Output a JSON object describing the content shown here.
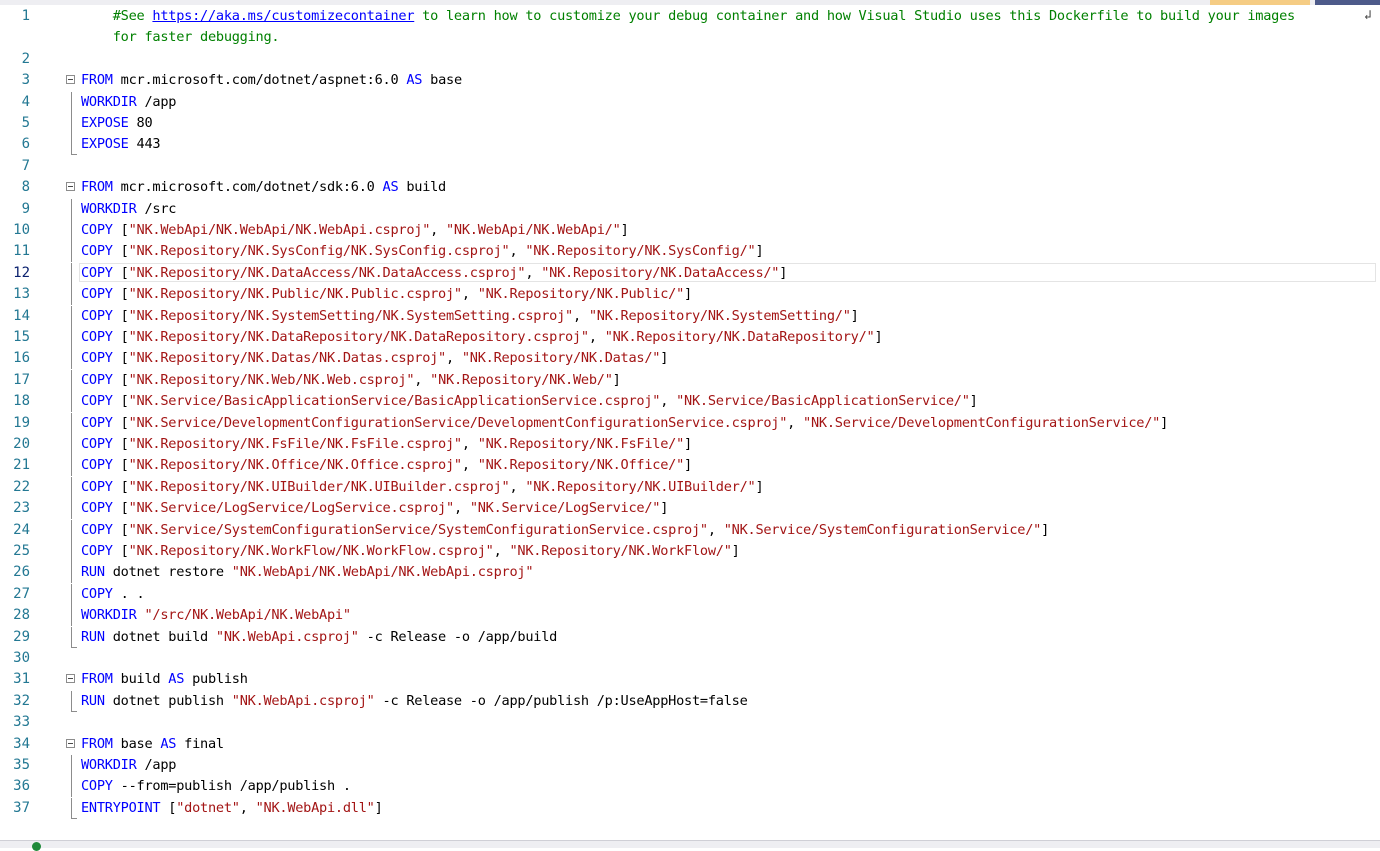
{
  "editor": {
    "language": "Dockerfile",
    "active_line": 12,
    "lines": [
      {
        "n": "1",
        "parts": [
          {
            "t": "    ",
            "c": "cmt"
          },
          {
            "t": "#See ",
            "c": "cmt"
          },
          {
            "t": "https://aka.ms/customizecontainer",
            "c": "link"
          },
          {
            "t": " to learn how to customize your debug container and how Visual Studio uses this Dockerfile to build your images",
            "c": "cmt"
          }
        ]
      },
      {
        "n": "",
        "parts": [
          {
            "t": "    for faster debugging.",
            "c": "cmt"
          }
        ]
      },
      {
        "n": "2",
        "parts": []
      },
      {
        "n": "3",
        "parts": [
          {
            "t": "FROM",
            "c": "kw"
          },
          {
            "t": " mcr.microsoft.com/dotnet/aspnet:6.0 ",
            "c": ""
          },
          {
            "t": "AS",
            "c": "kw"
          },
          {
            "t": " base",
            "c": ""
          }
        ]
      },
      {
        "n": "4",
        "parts": [
          {
            "t": "WORKDIR",
            "c": "kw"
          },
          {
            "t": " /app",
            "c": ""
          }
        ]
      },
      {
        "n": "5",
        "parts": [
          {
            "t": "EXPOSE",
            "c": "kw"
          },
          {
            "t": " 80",
            "c": ""
          }
        ]
      },
      {
        "n": "6",
        "parts": [
          {
            "t": "EXPOSE",
            "c": "kw"
          },
          {
            "t": " 443",
            "c": ""
          }
        ]
      },
      {
        "n": "7",
        "parts": []
      },
      {
        "n": "8",
        "parts": [
          {
            "t": "FROM",
            "c": "kw"
          },
          {
            "t": " mcr.microsoft.com/dotnet/sdk:6.0 ",
            "c": ""
          },
          {
            "t": "AS",
            "c": "kw"
          },
          {
            "t": " build",
            "c": ""
          }
        ]
      },
      {
        "n": "9",
        "parts": [
          {
            "t": "WORKDIR",
            "c": "kw"
          },
          {
            "t": " /src",
            "c": ""
          }
        ]
      },
      {
        "n": "10",
        "parts": [
          {
            "t": "COPY",
            "c": "kw"
          },
          {
            "t": " [",
            "c": ""
          },
          {
            "t": "\"NK.WebApi/NK.WebApi/NK.WebApi.csproj\"",
            "c": "str"
          },
          {
            "t": ", ",
            "c": ""
          },
          {
            "t": "\"NK.WebApi/NK.WebApi/\"",
            "c": "str"
          },
          {
            "t": "]",
            "c": ""
          }
        ]
      },
      {
        "n": "11",
        "parts": [
          {
            "t": "COPY",
            "c": "kw"
          },
          {
            "t": " [",
            "c": ""
          },
          {
            "t": "\"NK.Repository/NK.SysConfig/NK.SysConfig.csproj\"",
            "c": "str"
          },
          {
            "t": ", ",
            "c": ""
          },
          {
            "t": "\"NK.Repository/NK.SysConfig/\"",
            "c": "str"
          },
          {
            "t": "]",
            "c": ""
          }
        ]
      },
      {
        "n": "12",
        "parts": [
          {
            "t": "COPY",
            "c": "kw"
          },
          {
            "t": " [",
            "c": ""
          },
          {
            "t": "\"NK.Repository/NK.DataAccess/NK.DataAccess.csproj\"",
            "c": "str"
          },
          {
            "t": ", ",
            "c": ""
          },
          {
            "t": "\"NK.Repository/NK.DataAccess/\"",
            "c": "str"
          },
          {
            "t": "]",
            "c": ""
          }
        ]
      },
      {
        "n": "13",
        "parts": [
          {
            "t": "COPY",
            "c": "kw"
          },
          {
            "t": " [",
            "c": ""
          },
          {
            "t": "\"NK.Repository/NK.Public/NK.Public.csproj\"",
            "c": "str"
          },
          {
            "t": ", ",
            "c": ""
          },
          {
            "t": "\"NK.Repository/NK.Public/\"",
            "c": "str"
          },
          {
            "t": "]",
            "c": ""
          }
        ]
      },
      {
        "n": "14",
        "parts": [
          {
            "t": "COPY",
            "c": "kw"
          },
          {
            "t": " [",
            "c": ""
          },
          {
            "t": "\"NK.Repository/NK.SystemSetting/NK.SystemSetting.csproj\"",
            "c": "str"
          },
          {
            "t": ", ",
            "c": ""
          },
          {
            "t": "\"NK.Repository/NK.SystemSetting/\"",
            "c": "str"
          },
          {
            "t": "]",
            "c": ""
          }
        ]
      },
      {
        "n": "15",
        "parts": [
          {
            "t": "COPY",
            "c": "kw"
          },
          {
            "t": " [",
            "c": ""
          },
          {
            "t": "\"NK.Repository/NK.DataRepository/NK.DataRepository.csproj\"",
            "c": "str"
          },
          {
            "t": ", ",
            "c": ""
          },
          {
            "t": "\"NK.Repository/NK.DataRepository/\"",
            "c": "str"
          },
          {
            "t": "]",
            "c": ""
          }
        ]
      },
      {
        "n": "16",
        "parts": [
          {
            "t": "COPY",
            "c": "kw"
          },
          {
            "t": " [",
            "c": ""
          },
          {
            "t": "\"NK.Repository/NK.Datas/NK.Datas.csproj\"",
            "c": "str"
          },
          {
            "t": ", ",
            "c": ""
          },
          {
            "t": "\"NK.Repository/NK.Datas/\"",
            "c": "str"
          },
          {
            "t": "]",
            "c": ""
          }
        ]
      },
      {
        "n": "17",
        "parts": [
          {
            "t": "COPY",
            "c": "kw"
          },
          {
            "t": " [",
            "c": ""
          },
          {
            "t": "\"NK.Repository/NK.Web/NK.Web.csproj\"",
            "c": "str"
          },
          {
            "t": ", ",
            "c": ""
          },
          {
            "t": "\"NK.Repository/NK.Web/\"",
            "c": "str"
          },
          {
            "t": "]",
            "c": ""
          }
        ]
      },
      {
        "n": "18",
        "parts": [
          {
            "t": "COPY",
            "c": "kw"
          },
          {
            "t": " [",
            "c": ""
          },
          {
            "t": "\"NK.Service/BasicApplicationService/BasicApplicationService.csproj\"",
            "c": "str"
          },
          {
            "t": ", ",
            "c": ""
          },
          {
            "t": "\"NK.Service/BasicApplicationService/\"",
            "c": "str"
          },
          {
            "t": "]",
            "c": ""
          }
        ]
      },
      {
        "n": "19",
        "parts": [
          {
            "t": "COPY",
            "c": "kw"
          },
          {
            "t": " [",
            "c": ""
          },
          {
            "t": "\"NK.Service/DevelopmentConfigurationService/DevelopmentConfigurationService.csproj\"",
            "c": "str"
          },
          {
            "t": ", ",
            "c": ""
          },
          {
            "t": "\"NK.Service/DevelopmentConfigurationService/\"",
            "c": "str"
          },
          {
            "t": "]",
            "c": ""
          }
        ]
      },
      {
        "n": "20",
        "parts": [
          {
            "t": "COPY",
            "c": "kw"
          },
          {
            "t": " [",
            "c": ""
          },
          {
            "t": "\"NK.Repository/NK.FsFile/NK.FsFile.csproj\"",
            "c": "str"
          },
          {
            "t": ", ",
            "c": ""
          },
          {
            "t": "\"NK.Repository/NK.FsFile/\"",
            "c": "str"
          },
          {
            "t": "]",
            "c": ""
          }
        ]
      },
      {
        "n": "21",
        "parts": [
          {
            "t": "COPY",
            "c": "kw"
          },
          {
            "t": " [",
            "c": ""
          },
          {
            "t": "\"NK.Repository/NK.Office/NK.Office.csproj\"",
            "c": "str"
          },
          {
            "t": ", ",
            "c": ""
          },
          {
            "t": "\"NK.Repository/NK.Office/\"",
            "c": "str"
          },
          {
            "t": "]",
            "c": ""
          }
        ]
      },
      {
        "n": "22",
        "parts": [
          {
            "t": "COPY",
            "c": "kw"
          },
          {
            "t": " [",
            "c": ""
          },
          {
            "t": "\"NK.Repository/NK.UIBuilder/NK.UIBuilder.csproj\"",
            "c": "str"
          },
          {
            "t": ", ",
            "c": ""
          },
          {
            "t": "\"NK.Repository/NK.UIBuilder/\"",
            "c": "str"
          },
          {
            "t": "]",
            "c": ""
          }
        ]
      },
      {
        "n": "23",
        "parts": [
          {
            "t": "COPY",
            "c": "kw"
          },
          {
            "t": " [",
            "c": ""
          },
          {
            "t": "\"NK.Service/LogService/LogService.csproj\"",
            "c": "str"
          },
          {
            "t": ", ",
            "c": ""
          },
          {
            "t": "\"NK.Service/LogService/\"",
            "c": "str"
          },
          {
            "t": "]",
            "c": ""
          }
        ]
      },
      {
        "n": "24",
        "parts": [
          {
            "t": "COPY",
            "c": "kw"
          },
          {
            "t": " [",
            "c": ""
          },
          {
            "t": "\"NK.Service/SystemConfigurationService/SystemConfigurationService.csproj\"",
            "c": "str"
          },
          {
            "t": ", ",
            "c": ""
          },
          {
            "t": "\"NK.Service/SystemConfigurationService/\"",
            "c": "str"
          },
          {
            "t": "]",
            "c": ""
          }
        ]
      },
      {
        "n": "25",
        "parts": [
          {
            "t": "COPY",
            "c": "kw"
          },
          {
            "t": " [",
            "c": ""
          },
          {
            "t": "\"NK.Repository/NK.WorkFlow/NK.WorkFlow.csproj\"",
            "c": "str"
          },
          {
            "t": ", ",
            "c": ""
          },
          {
            "t": "\"NK.Repository/NK.WorkFlow/\"",
            "c": "str"
          },
          {
            "t": "]",
            "c": ""
          }
        ]
      },
      {
        "n": "26",
        "parts": [
          {
            "t": "RUN",
            "c": "kw"
          },
          {
            "t": " dotnet restore ",
            "c": ""
          },
          {
            "t": "\"NK.WebApi/NK.WebApi/NK.WebApi.csproj\"",
            "c": "str"
          }
        ]
      },
      {
        "n": "27",
        "parts": [
          {
            "t": "COPY",
            "c": "kw"
          },
          {
            "t": " . .",
            "c": ""
          }
        ]
      },
      {
        "n": "28",
        "parts": [
          {
            "t": "WORKDIR",
            "c": "kw"
          },
          {
            "t": " ",
            "c": ""
          },
          {
            "t": "\"/src/NK.WebApi/NK.WebApi\"",
            "c": "str"
          }
        ]
      },
      {
        "n": "29",
        "parts": [
          {
            "t": "RUN",
            "c": "kw"
          },
          {
            "t": " dotnet build ",
            "c": ""
          },
          {
            "t": "\"NK.WebApi.csproj\"",
            "c": "str"
          },
          {
            "t": " -c Release -o /app/build",
            "c": ""
          }
        ]
      },
      {
        "n": "30",
        "parts": []
      },
      {
        "n": "31",
        "parts": [
          {
            "t": "FROM",
            "c": "kw"
          },
          {
            "t": " build ",
            "c": ""
          },
          {
            "t": "AS",
            "c": "kw"
          },
          {
            "t": " publish",
            "c": ""
          }
        ]
      },
      {
        "n": "32",
        "parts": [
          {
            "t": "RUN",
            "c": "kw"
          },
          {
            "t": " dotnet publish ",
            "c": ""
          },
          {
            "t": "\"NK.WebApi.csproj\"",
            "c": "str"
          },
          {
            "t": " -c Release -o /app/publish /p:UseAppHost=false",
            "c": ""
          }
        ]
      },
      {
        "n": "33",
        "parts": []
      },
      {
        "n": "34",
        "parts": [
          {
            "t": "FROM",
            "c": "kw"
          },
          {
            "t": " base ",
            "c": ""
          },
          {
            "t": "AS",
            "c": "kw"
          },
          {
            "t": " final",
            "c": ""
          }
        ]
      },
      {
        "n": "35",
        "parts": [
          {
            "t": "WORKDIR",
            "c": "kw"
          },
          {
            "t": " /app",
            "c": ""
          }
        ]
      },
      {
        "n": "36",
        "parts": [
          {
            "t": "COPY",
            "c": "kw"
          },
          {
            "t": " --from=publish /app/publish .",
            "c": ""
          }
        ]
      },
      {
        "n": "37",
        "parts": [
          {
            "t": "ENTRYPOINT",
            "c": "kw"
          },
          {
            "t": " [",
            "c": ""
          },
          {
            "t": "\"dotnet\"",
            "c": "str"
          },
          {
            "t": ", ",
            "c": ""
          },
          {
            "t": "\"NK.WebApi.dll\"",
            "c": "str"
          },
          {
            "t": "]",
            "c": ""
          }
        ]
      }
    ]
  },
  "colors": {
    "keyword": "#0000ff",
    "string": "#a31515",
    "comment": "#008000",
    "line_number": "#237893",
    "status_ok": "#1f8a3a"
  },
  "icons": {
    "wrap": "word-wrap-icon",
    "fold": "fold-collapse-icon",
    "status": "no-issues-found-icon"
  }
}
